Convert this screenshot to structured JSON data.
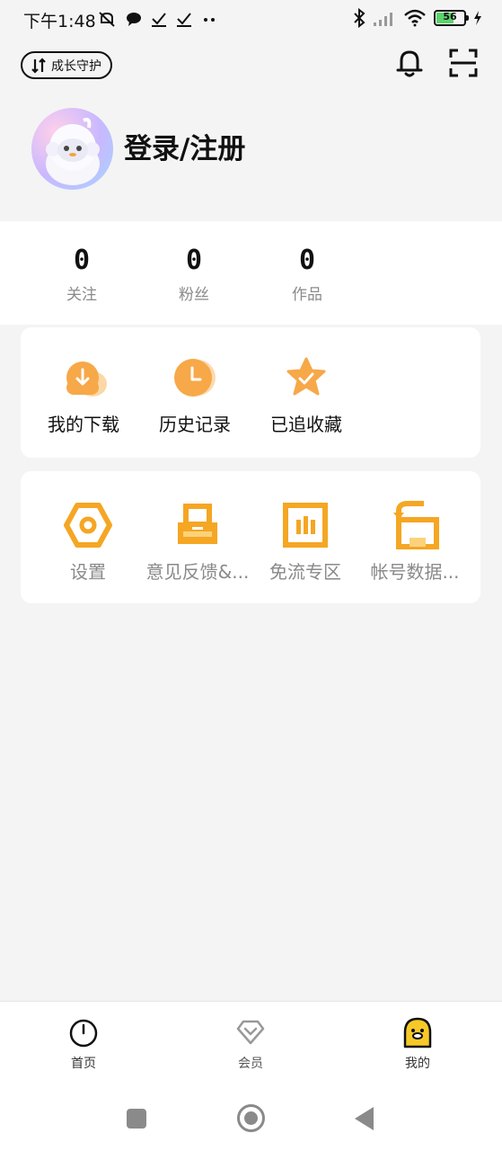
{
  "status_bar": {
    "time": "下午1:48",
    "battery": "56",
    "icons": [
      "mute-icon",
      "chat-icon",
      "check-icon",
      "check-icon",
      "dots-icon",
      "bluetooth-icon",
      "signal-icon",
      "wifi-icon",
      "battery-icon",
      "charging-icon"
    ]
  },
  "header": {
    "growth_label": "成长守护",
    "bell_icon": "bell-icon",
    "scan_icon": "scan-icon"
  },
  "profile": {
    "login_text": "登录/注册"
  },
  "stats": [
    {
      "value": "0",
      "label": "关注"
    },
    {
      "value": "0",
      "label": "粉丝"
    },
    {
      "value": "0",
      "label": "作品"
    }
  ],
  "quick_actions": [
    {
      "label": "我的下载",
      "icon": "download-cloud-icon"
    },
    {
      "label": "历史记录",
      "icon": "clock-icon"
    },
    {
      "label": "已追收藏",
      "icon": "star-icon"
    }
  ],
  "tools": [
    {
      "label": "设置",
      "icon": "hex-settings-icon"
    },
    {
      "label": "意见反馈&...",
      "icon": "feedback-icon"
    },
    {
      "label": "免流专区",
      "icon": "free-data-icon"
    },
    {
      "label": "帐号数据...",
      "icon": "account-data-icon"
    }
  ],
  "bottom_nav": [
    {
      "label": "首页",
      "icon": "home-icon"
    },
    {
      "label": "会员",
      "icon": "vip-icon"
    },
    {
      "label": "我的",
      "icon": "duck-icon"
    }
  ],
  "colors": {
    "accent_orange": "#f5a33b",
    "accent_yellow": "#f7b42c",
    "background": "#f4f4f4",
    "muted_text": "#8a8a8a"
  }
}
